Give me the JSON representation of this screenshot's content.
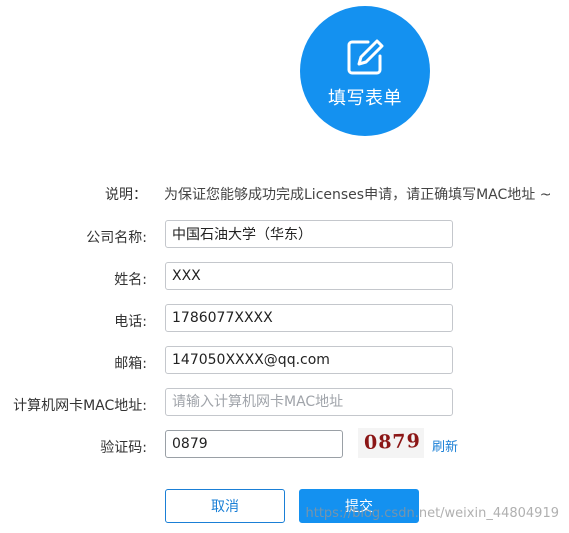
{
  "hero": {
    "title": "填写表单",
    "icon": "edit-form-icon",
    "color": "#1491f0"
  },
  "form": {
    "description": {
      "label": "说明：",
      "text": "为保证您能够成功完成Licenses申请，请正确填写MAC地址 ~"
    },
    "company": {
      "label": "公司名称:",
      "value": "中国石油大学（华东）"
    },
    "name": {
      "label": "姓名:",
      "value": "XXX"
    },
    "phone": {
      "label": "电话:",
      "value": "1786077XXXX"
    },
    "email": {
      "label": "邮箱:",
      "value": "147050XXXX@qq.com"
    },
    "mac": {
      "label": "计算机网卡MAC地址:",
      "value": "",
      "placeholder": "请输入计算机网卡MAC地址"
    },
    "captcha": {
      "label": "验证码:",
      "value": "0879",
      "image_text": "0879",
      "refresh_label": "刷新"
    }
  },
  "actions": {
    "cancel_label": "取消",
    "submit_label": "提交"
  },
  "watermark": "https://blog.csdn.net/weixin_44804919"
}
